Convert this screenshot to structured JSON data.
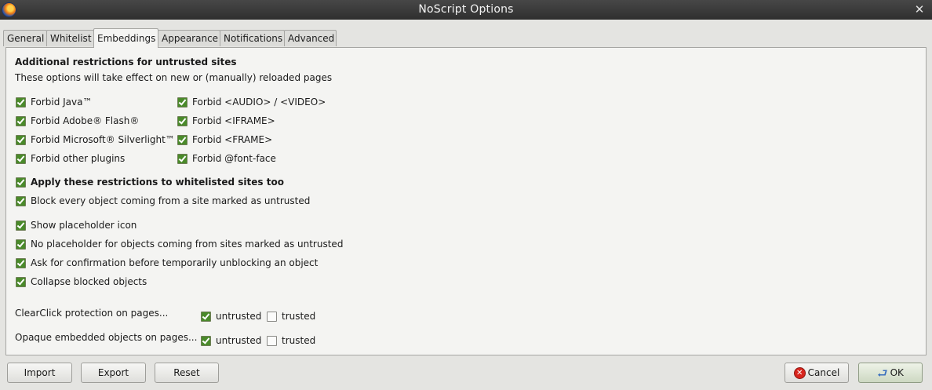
{
  "window": {
    "title": "NoScript Options",
    "close_glyph": "✕"
  },
  "tabs": [
    {
      "label": "General"
    },
    {
      "label": "Whitelist"
    },
    {
      "label": "Embeddings",
      "active": true
    },
    {
      "label": "Appearance"
    },
    {
      "label": "Notifications"
    },
    {
      "label": "Advanced"
    }
  ],
  "embeddings": {
    "heading": "Additional restrictions for untrusted sites",
    "subtext": "These options will take effect on new or (manually) reloaded pages",
    "left_options": [
      {
        "label": "Forbid Java™",
        "checked": true
      },
      {
        "label": "Forbid Adobe® Flash®",
        "checked": true
      },
      {
        "label": "Forbid Microsoft® Silverlight™",
        "checked": true
      },
      {
        "label": "Forbid other plugins",
        "checked": true
      }
    ],
    "right_options": [
      {
        "label": "Forbid <AUDIO> / <VIDEO>",
        "checked": true
      },
      {
        "label": "Forbid <IFRAME>",
        "checked": true
      },
      {
        "label": "Forbid <FRAME>",
        "checked": true
      },
      {
        "label": "Forbid @font-face",
        "checked": true
      }
    ],
    "apply_whitelisted": {
      "label": "Apply these restrictions to whitelisted sites too",
      "checked": true
    },
    "block_untrusted": {
      "label": "Block every object coming from a site marked as untrusted",
      "checked": true
    },
    "show_placeholder": {
      "label": "Show placeholder icon",
      "checked": true
    },
    "no_placeholder_untrusted": {
      "label": "No placeholder for objects coming from sites marked as untrusted",
      "checked": true
    },
    "ask_confirmation": {
      "label": "Ask for confirmation before temporarily unblocking an object",
      "checked": true
    },
    "collapse_blocked": {
      "label": "Collapse blocked objects",
      "checked": true
    },
    "clearclick": {
      "label": "ClearClick protection on pages...",
      "untrusted": {
        "label": "untrusted",
        "checked": true
      },
      "trusted": {
        "label": "trusted",
        "checked": false
      }
    },
    "opaque": {
      "label": "Opaque embedded objects on pages...",
      "untrusted": {
        "label": "untrusted",
        "checked": true
      },
      "trusted": {
        "label": "trusted",
        "checked": false
      }
    }
  },
  "buttons": {
    "import": "Import",
    "export": "Export",
    "reset": "Reset",
    "cancel": "Cancel",
    "ok": "OK"
  },
  "colors": {
    "checkbox_checked": "#4a8a2a",
    "titlebar": "#3a3a3a",
    "cancel_icon": "#d8251d"
  },
  "icons": {
    "app": "firefox-icon",
    "cancel": "cancel-icon",
    "ok": "ok-arrow-icon"
  }
}
